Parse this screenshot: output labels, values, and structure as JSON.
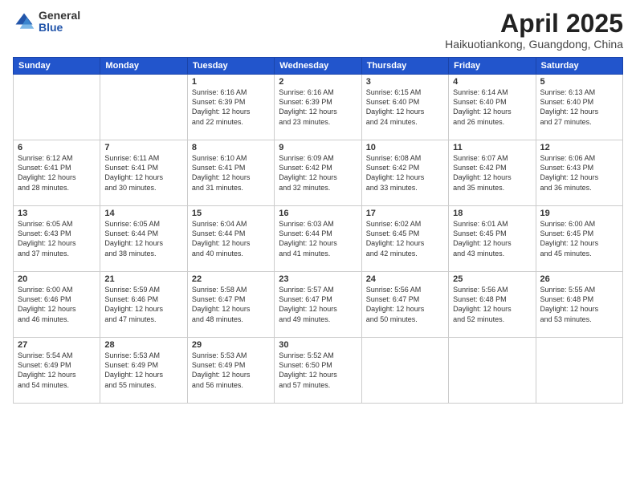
{
  "header": {
    "logo_general": "General",
    "logo_blue": "Blue",
    "title": "April 2025",
    "location": "Haikuotiankong, Guangdong, China"
  },
  "weekdays": [
    "Sunday",
    "Monday",
    "Tuesday",
    "Wednesday",
    "Thursday",
    "Friday",
    "Saturday"
  ],
  "weeks": [
    [
      {
        "day": "",
        "info": ""
      },
      {
        "day": "",
        "info": ""
      },
      {
        "day": "1",
        "info": "Sunrise: 6:16 AM\nSunset: 6:39 PM\nDaylight: 12 hours\nand 22 minutes."
      },
      {
        "day": "2",
        "info": "Sunrise: 6:16 AM\nSunset: 6:39 PM\nDaylight: 12 hours\nand 23 minutes."
      },
      {
        "day": "3",
        "info": "Sunrise: 6:15 AM\nSunset: 6:40 PM\nDaylight: 12 hours\nand 24 minutes."
      },
      {
        "day": "4",
        "info": "Sunrise: 6:14 AM\nSunset: 6:40 PM\nDaylight: 12 hours\nand 26 minutes."
      },
      {
        "day": "5",
        "info": "Sunrise: 6:13 AM\nSunset: 6:40 PM\nDaylight: 12 hours\nand 27 minutes."
      }
    ],
    [
      {
        "day": "6",
        "info": "Sunrise: 6:12 AM\nSunset: 6:41 PM\nDaylight: 12 hours\nand 28 minutes."
      },
      {
        "day": "7",
        "info": "Sunrise: 6:11 AM\nSunset: 6:41 PM\nDaylight: 12 hours\nand 30 minutes."
      },
      {
        "day": "8",
        "info": "Sunrise: 6:10 AM\nSunset: 6:41 PM\nDaylight: 12 hours\nand 31 minutes."
      },
      {
        "day": "9",
        "info": "Sunrise: 6:09 AM\nSunset: 6:42 PM\nDaylight: 12 hours\nand 32 minutes."
      },
      {
        "day": "10",
        "info": "Sunrise: 6:08 AM\nSunset: 6:42 PM\nDaylight: 12 hours\nand 33 minutes."
      },
      {
        "day": "11",
        "info": "Sunrise: 6:07 AM\nSunset: 6:42 PM\nDaylight: 12 hours\nand 35 minutes."
      },
      {
        "day": "12",
        "info": "Sunrise: 6:06 AM\nSunset: 6:43 PM\nDaylight: 12 hours\nand 36 minutes."
      }
    ],
    [
      {
        "day": "13",
        "info": "Sunrise: 6:05 AM\nSunset: 6:43 PM\nDaylight: 12 hours\nand 37 minutes."
      },
      {
        "day": "14",
        "info": "Sunrise: 6:05 AM\nSunset: 6:44 PM\nDaylight: 12 hours\nand 38 minutes."
      },
      {
        "day": "15",
        "info": "Sunrise: 6:04 AM\nSunset: 6:44 PM\nDaylight: 12 hours\nand 40 minutes."
      },
      {
        "day": "16",
        "info": "Sunrise: 6:03 AM\nSunset: 6:44 PM\nDaylight: 12 hours\nand 41 minutes."
      },
      {
        "day": "17",
        "info": "Sunrise: 6:02 AM\nSunset: 6:45 PM\nDaylight: 12 hours\nand 42 minutes."
      },
      {
        "day": "18",
        "info": "Sunrise: 6:01 AM\nSunset: 6:45 PM\nDaylight: 12 hours\nand 43 minutes."
      },
      {
        "day": "19",
        "info": "Sunrise: 6:00 AM\nSunset: 6:45 PM\nDaylight: 12 hours\nand 45 minutes."
      }
    ],
    [
      {
        "day": "20",
        "info": "Sunrise: 6:00 AM\nSunset: 6:46 PM\nDaylight: 12 hours\nand 46 minutes."
      },
      {
        "day": "21",
        "info": "Sunrise: 5:59 AM\nSunset: 6:46 PM\nDaylight: 12 hours\nand 47 minutes."
      },
      {
        "day": "22",
        "info": "Sunrise: 5:58 AM\nSunset: 6:47 PM\nDaylight: 12 hours\nand 48 minutes."
      },
      {
        "day": "23",
        "info": "Sunrise: 5:57 AM\nSunset: 6:47 PM\nDaylight: 12 hours\nand 49 minutes."
      },
      {
        "day": "24",
        "info": "Sunrise: 5:56 AM\nSunset: 6:47 PM\nDaylight: 12 hours\nand 50 minutes."
      },
      {
        "day": "25",
        "info": "Sunrise: 5:56 AM\nSunset: 6:48 PM\nDaylight: 12 hours\nand 52 minutes."
      },
      {
        "day": "26",
        "info": "Sunrise: 5:55 AM\nSunset: 6:48 PM\nDaylight: 12 hours\nand 53 minutes."
      }
    ],
    [
      {
        "day": "27",
        "info": "Sunrise: 5:54 AM\nSunset: 6:49 PM\nDaylight: 12 hours\nand 54 minutes."
      },
      {
        "day": "28",
        "info": "Sunrise: 5:53 AM\nSunset: 6:49 PM\nDaylight: 12 hours\nand 55 minutes."
      },
      {
        "day": "29",
        "info": "Sunrise: 5:53 AM\nSunset: 6:49 PM\nDaylight: 12 hours\nand 56 minutes."
      },
      {
        "day": "30",
        "info": "Sunrise: 5:52 AM\nSunset: 6:50 PM\nDaylight: 12 hours\nand 57 minutes."
      },
      {
        "day": "",
        "info": ""
      },
      {
        "day": "",
        "info": ""
      },
      {
        "day": "",
        "info": ""
      }
    ]
  ]
}
